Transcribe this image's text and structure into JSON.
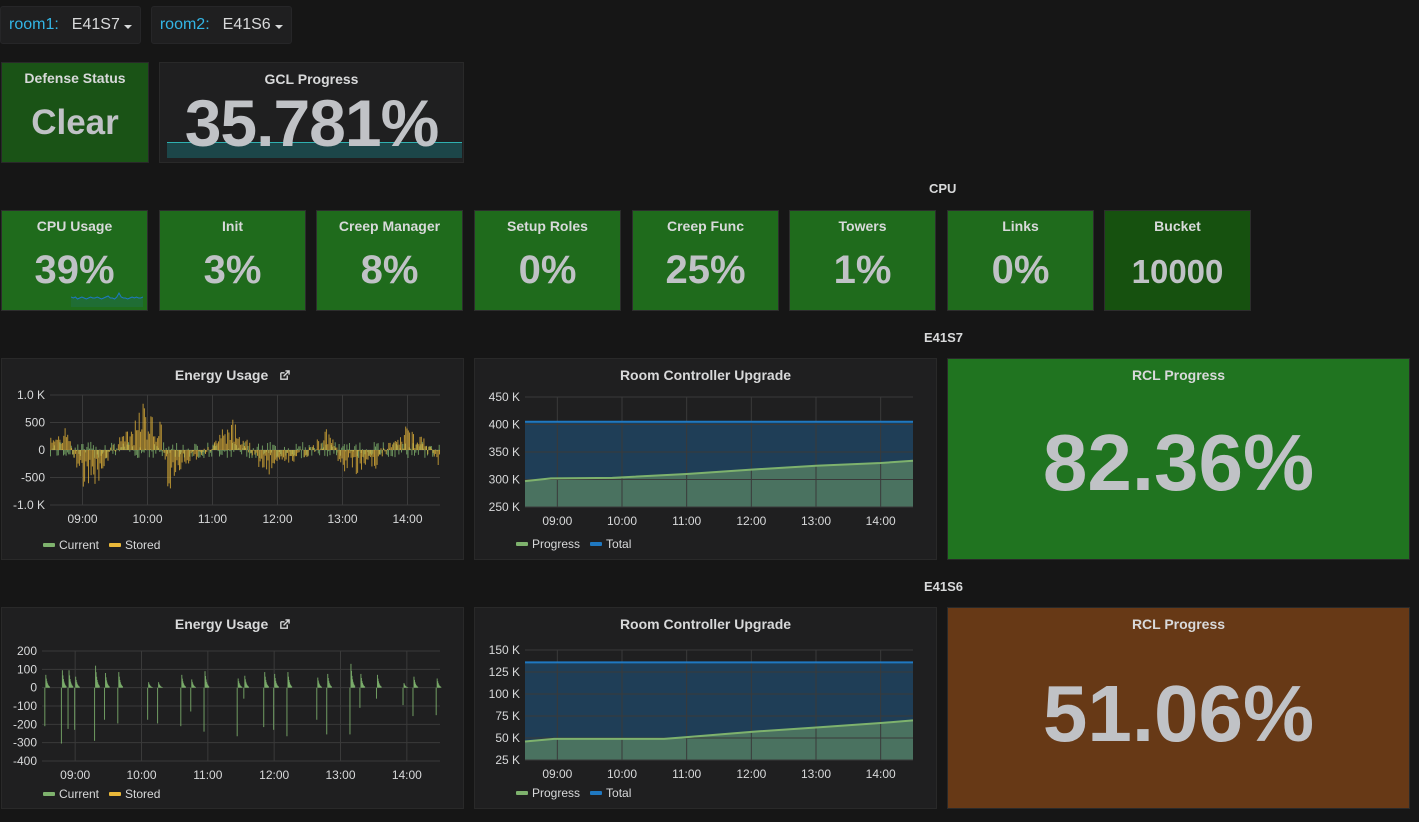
{
  "variables": [
    {
      "label": "room1:",
      "value": "E41S7"
    },
    {
      "label": "room2:",
      "value": "E41S6"
    }
  ],
  "top": {
    "defense": {
      "title": "Defense Status",
      "value": "Clear"
    },
    "gcl": {
      "title": "GCL Progress",
      "value": "35.781%",
      "gauge_fraction": 0.35781
    }
  },
  "sections": {
    "cpu": "CPU",
    "room1": "E41S7",
    "room2": "E41S6"
  },
  "cpu_stats": [
    {
      "title": "CPU Usage",
      "value": "39%"
    },
    {
      "title": "Init",
      "value": "3%"
    },
    {
      "title": "Creep Manager",
      "value": "8%"
    },
    {
      "title": "Setup Roles",
      "value": "0%"
    },
    {
      "title": "Creep Func",
      "value": "25%"
    },
    {
      "title": "Towers",
      "value": "1%"
    },
    {
      "title": "Links",
      "value": "0%"
    },
    {
      "title": "Bucket",
      "value": "10000"
    }
  ],
  "colors": {
    "current": "#7eb26d",
    "stored": "#eab839",
    "progress": "#7eb26d",
    "total": "#1f78c1",
    "stat_green": "#1f6b1c",
    "stat_dark_green": "#16510f",
    "rcl_green": "#207420",
    "rcl_orange": "#673916",
    "variable_label": "#33b5e5"
  },
  "rooms": [
    {
      "energy": {
        "title": "Energy Usage",
        "legend": [
          "Current",
          "Stored"
        ]
      },
      "rcu": {
        "title": "Room Controller Upgrade",
        "legend": [
          "Progress",
          "Total"
        ]
      },
      "rcl": {
        "title": "RCL Progress",
        "value": "82.36%"
      }
    },
    {
      "energy": {
        "title": "Energy Usage",
        "legend": [
          "Current",
          "Stored"
        ]
      },
      "rcu": {
        "title": "Room Controller Upgrade",
        "legend": [
          "Progress",
          "Total"
        ]
      },
      "rcl": {
        "title": "RCL Progress",
        "value": "51.06%"
      }
    }
  ],
  "chart_data": [
    {
      "id": "energy1",
      "type": "bar",
      "title": "Energy Usage",
      "x_ticks": [
        "09:00",
        "10:00",
        "11:00",
        "12:00",
        "13:00",
        "14:00"
      ],
      "x_range": [
        "08:30",
        "14:30"
      ],
      "y_ticks": [
        "1.0 K",
        "500",
        "0",
        "-500",
        "-1.0 K"
      ],
      "ylim": [
        -1000,
        1000
      ],
      "series": [
        {
          "name": "Current",
          "note": "dense small bars roughly -300..200"
        },
        {
          "name": "Stored",
          "note": "dense bars mostly -900..950, peaks ~950 near 09:55, trough ~-900 near 10:15"
        }
      ],
      "seed_profile": [
        [
          8.5,
          250
        ],
        [
          8.75,
          300
        ],
        [
          9.0,
          -550
        ],
        [
          9.25,
          -400
        ],
        [
          9.5,
          150
        ],
        [
          9.75,
          250
        ],
        [
          9.95,
          700
        ],
        [
          10.2,
          300
        ],
        [
          10.3,
          -600
        ],
        [
          10.5,
          -250
        ],
        [
          10.75,
          -150
        ],
        [
          11.0,
          150
        ],
        [
          11.25,
          400
        ],
        [
          11.5,
          200
        ],
        [
          11.75,
          -300
        ],
        [
          12.0,
          -200
        ],
        [
          12.25,
          -150
        ],
        [
          12.5,
          0
        ],
        [
          12.75,
          350
        ],
        [
          13.0,
          -300
        ],
        [
          13.25,
          -250
        ],
        [
          13.5,
          -200
        ],
        [
          13.75,
          100
        ],
        [
          14.0,
          300
        ],
        [
          14.25,
          150
        ],
        [
          14.5,
          -350
        ]
      ],
      "legend": [
        "Current",
        "Stored"
      ]
    },
    {
      "id": "rcu1",
      "type": "area",
      "title": "Room Controller Upgrade",
      "x_ticks": [
        "09:00",
        "10:00",
        "11:00",
        "12:00",
        "13:00",
        "14:00"
      ],
      "y_ticks": [
        "450 K",
        "400 K",
        "350 K",
        "300 K",
        "250 K"
      ],
      "ylim": [
        250000,
        450000
      ],
      "x": [
        8.5,
        8.9,
        9.85,
        11.0,
        12.0,
        13.0,
        14.0,
        14.5
      ],
      "series": [
        {
          "name": "Progress",
          "values": [
            297000,
            302000,
            303000,
            310000,
            318000,
            325000,
            330000,
            334000
          ]
        },
        {
          "name": "Total",
          "values": [
            405000,
            405000,
            405000,
            405000,
            405000,
            405000,
            405000,
            405000
          ]
        }
      ],
      "legend": [
        "Progress",
        "Total"
      ]
    },
    {
      "id": "energy2",
      "type": "bar",
      "title": "Energy Usage",
      "x_ticks": [
        "09:00",
        "10:00",
        "11:00",
        "12:00",
        "13:00",
        "14:00"
      ],
      "y_ticks": [
        "200",
        "100",
        "0",
        "-100",
        "-200",
        "-300",
        "-400"
      ],
      "ylim": [
        -400,
        200
      ],
      "series": [
        {
          "name": "Current",
          "spikes": [
            [
              8.55,
              70,
              -210
            ],
            [
              8.8,
              95,
              -305
            ],
            [
              8.9,
              95,
              -225
            ],
            [
              9.0,
              60,
              -230
            ],
            [
              9.3,
              120,
              -290
            ],
            [
              9.45,
              80,
              -175
            ],
            [
              9.65,
              85,
              -195
            ],
            [
              10.1,
              30,
              -175
            ],
            [
              10.25,
              30,
              -195
            ],
            [
              10.6,
              70,
              -210
            ],
            [
              10.75,
              45,
              -130
            ],
            [
              10.95,
              90,
              -240
            ],
            [
              11.45,
              50,
              -265
            ],
            [
              11.55,
              65,
              -60
            ],
            [
              11.85,
              85,
              -215
            ],
            [
              12.0,
              75,
              -230
            ],
            [
              12.2,
              85,
              -265
            ],
            [
              12.65,
              55,
              -175
            ],
            [
              12.8,
              75,
              -255
            ],
            [
              13.15,
              130,
              -255
            ],
            [
              13.3,
              75,
              -110
            ],
            [
              13.55,
              70,
              -60
            ],
            [
              13.95,
              25,
              -95
            ],
            [
              14.1,
              60,
              -155
            ],
            [
              14.45,
              50,
              -150
            ]
          ]
        },
        {
          "name": "Stored",
          "values": []
        }
      ],
      "legend": [
        "Current",
        "Stored"
      ]
    },
    {
      "id": "rcu2",
      "type": "area",
      "title": "Room Controller Upgrade",
      "x_ticks": [
        "09:00",
        "10:00",
        "11:00",
        "12:00",
        "13:00",
        "14:00"
      ],
      "y_ticks": [
        "150 K",
        "125 K",
        "100 K",
        "75 K",
        "50 K",
        "25 K"
      ],
      "ylim": [
        25000,
        150000
      ],
      "x": [
        8.5,
        8.95,
        10.0,
        10.65,
        11.0,
        12.0,
        13.0,
        14.0,
        14.5
      ],
      "series": [
        {
          "name": "Progress",
          "values": [
            46000,
            49000,
            49000,
            49000,
            51000,
            57000,
            62000,
            67000,
            70000
          ]
        },
        {
          "name": "Total",
          "values": [
            136000,
            136000,
            136000,
            136000,
            136000,
            136000,
            136000,
            136000,
            136000
          ]
        }
      ],
      "legend": [
        "Progress",
        "Total"
      ]
    }
  ]
}
